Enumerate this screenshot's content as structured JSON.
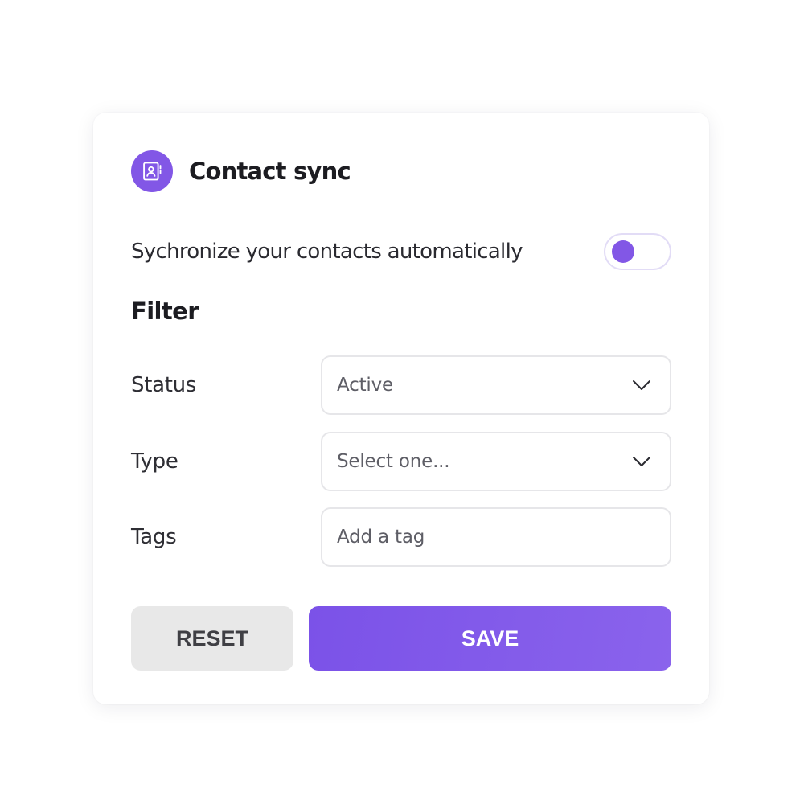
{
  "header": {
    "icon": "contact-book-icon",
    "title": "Contact sync"
  },
  "sync": {
    "label": "Sychronize your contacts automatically",
    "enabled": false
  },
  "filter": {
    "heading": "Filter",
    "fields": [
      {
        "label": "Status",
        "kind": "select",
        "value": "Active"
      },
      {
        "label": "Type",
        "kind": "select",
        "placeholder": "Select one..."
      },
      {
        "label": "Tags",
        "kind": "input",
        "placeholder": "Add a tag"
      }
    ]
  },
  "actions": {
    "reset_label": "RESET",
    "save_label": "SAVE"
  },
  "colors": {
    "accent": "#8257e6",
    "reset_bg": "#e8e8e8",
    "border": "#e6e6e9"
  }
}
